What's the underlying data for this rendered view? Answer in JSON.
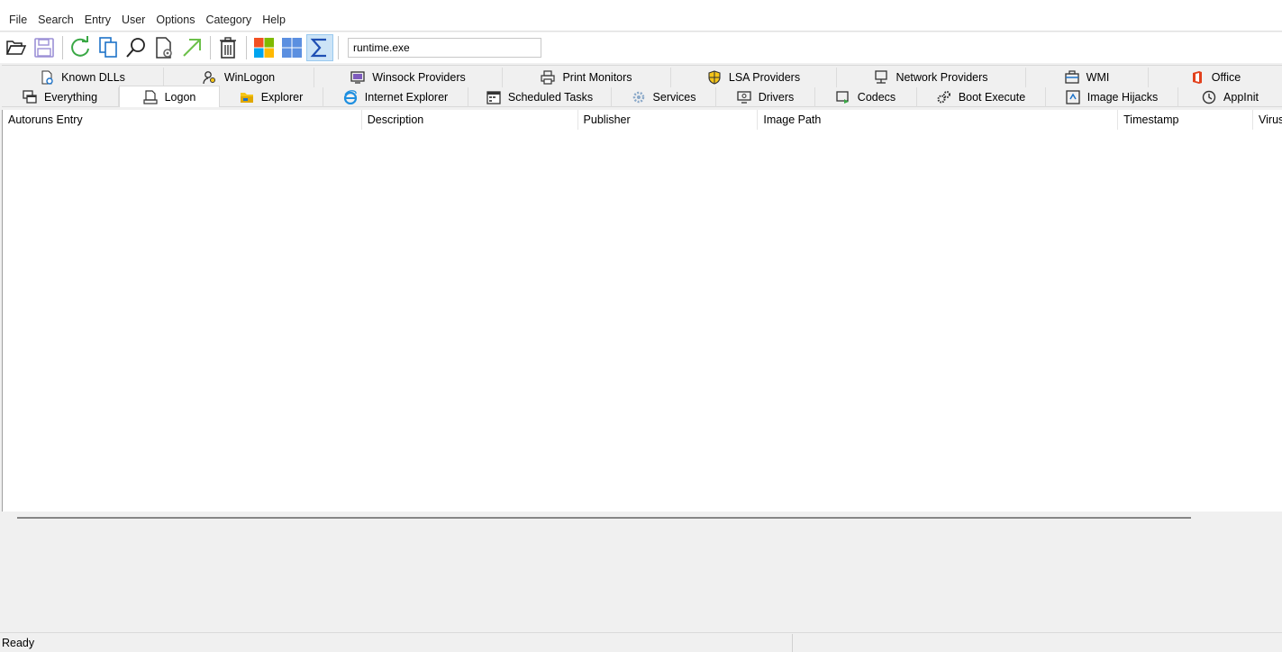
{
  "menu": [
    "File",
    "Search",
    "Entry",
    "User",
    "Options",
    "Category",
    "Help"
  ],
  "toolbar": {
    "filter_value": "runtime.exe",
    "icons": [
      "open-icon",
      "save-icon",
      "refresh-icon",
      "copy-icon",
      "find-icon",
      "properties-icon",
      "jump-icon",
      "delete-icon",
      "windows-entries-icon",
      "microsoft-entries-icon",
      "sigma-icon"
    ]
  },
  "tabs_row1": [
    {
      "label": "Known DLLs",
      "icon": "known-dlls-icon"
    },
    {
      "label": "WinLogon",
      "icon": "winlogon-icon"
    },
    {
      "label": "Winsock Providers",
      "icon": "winsock-icon"
    },
    {
      "label": "Print Monitors",
      "icon": "printer-icon"
    },
    {
      "label": "LSA Providers",
      "icon": "shield-icon"
    },
    {
      "label": "Network Providers",
      "icon": "network-icon"
    },
    {
      "label": "WMI",
      "icon": "wmi-icon"
    },
    {
      "label": "Office",
      "icon": "office-icon"
    }
  ],
  "tabs_row2": [
    {
      "label": "Everything",
      "icon": "windows-stack-icon"
    },
    {
      "label": "Logon",
      "icon": "logon-icon",
      "selected": true
    },
    {
      "label": "Explorer",
      "icon": "folder-icon"
    },
    {
      "label": "Internet Explorer",
      "icon": "ie-icon"
    },
    {
      "label": "Scheduled Tasks",
      "icon": "calendar-icon"
    },
    {
      "label": "Services",
      "icon": "gear-icon"
    },
    {
      "label": "Drivers",
      "icon": "monitor-icon"
    },
    {
      "label": "Codecs",
      "icon": "codec-icon"
    },
    {
      "label": "Boot Execute",
      "icon": "gears-icon"
    },
    {
      "label": "Image Hijacks",
      "icon": "hijack-icon"
    },
    {
      "label": "AppInit",
      "icon": "clock-icon"
    }
  ],
  "columns": [
    "Autoruns Entry",
    "Description",
    "Publisher",
    "Image Path",
    "Timestamp",
    "Virus"
  ],
  "status": "Ready",
  "colors": {
    "accent": "#0078d7",
    "selected_tool_bg": "#cce4f7"
  }
}
